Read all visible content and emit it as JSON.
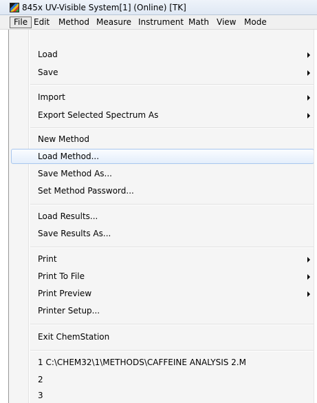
{
  "window": {
    "title": "845x UV-Visible System[1] (Online) [TK]",
    "icon": "chemstation-app-icon"
  },
  "menubar": {
    "items": [
      {
        "label": "File",
        "open": true
      },
      {
        "label": "Edit"
      },
      {
        "label": "Method"
      },
      {
        "label": "Measure"
      },
      {
        "label": "Instrument"
      },
      {
        "label": "Math"
      },
      {
        "label": "View"
      },
      {
        "label": "Mode"
      }
    ]
  },
  "file_menu": {
    "groups": [
      [
        {
          "label": "Load",
          "submenu": true
        },
        {
          "label": "Save",
          "submenu": true
        }
      ],
      [
        {
          "label": "Import",
          "submenu": true
        },
        {
          "label": "Export Selected Spectrum As",
          "submenu": true
        }
      ],
      [
        {
          "label": "New Method"
        },
        {
          "label": "Load Method...",
          "highlighted": true
        },
        {
          "label": "Save Method As..."
        },
        {
          "label": "Set Method Password..."
        }
      ],
      [
        {
          "label": "Load Results..."
        },
        {
          "label": "Save Results As..."
        }
      ],
      [
        {
          "label": "Print",
          "submenu": true
        },
        {
          "label": "Print To File",
          "submenu": true
        },
        {
          "label": "Print Preview",
          "submenu": true
        },
        {
          "label": "Printer Setup..."
        }
      ],
      [
        {
          "label": "Exit ChemStation"
        }
      ],
      [
        {
          "label": "1 C:\\CHEM32\\1\\METHODS\\CAFFEINE ANALYSIS 2.M"
        },
        {
          "label": "2"
        },
        {
          "label": "3"
        }
      ]
    ]
  }
}
